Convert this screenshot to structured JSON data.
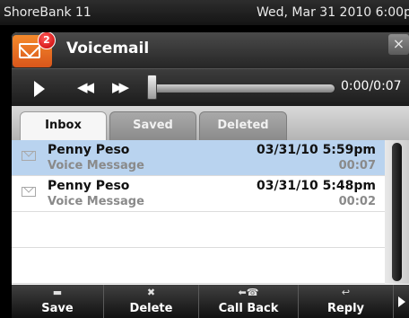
{
  "statusbar": {
    "carrier": "ShoreBank 11",
    "datetime": "Wed, Mar 31 2010 6:00pm"
  },
  "window": {
    "title": "Voicemail",
    "badge_count": "2",
    "close_glyph": "×",
    "app_icon": "envelope-icon"
  },
  "player": {
    "play_icon": "play-icon",
    "rewind_glyph": "◀◀",
    "ff_glyph": "▶▶",
    "position": 0,
    "time": "0:00/0:07"
  },
  "tabs": [
    {
      "label": "Inbox",
      "active": true
    },
    {
      "label": "Saved",
      "active": false
    },
    {
      "label": "Deleted",
      "active": false
    }
  ],
  "messages": [
    {
      "name": "Penny Peso",
      "type": "Voice Message",
      "date": "03/31/10 5:59pm",
      "duration": "00:07",
      "selected": true
    },
    {
      "name": "Penny Peso",
      "type": "Voice Message",
      "date": "03/31/10 5:48pm",
      "duration": "00:02",
      "selected": false
    }
  ],
  "toolbar": {
    "save": {
      "label": "Save",
      "icon": "folder-icon",
      "glyph": "▬"
    },
    "delete": {
      "label": "Delete",
      "icon": "x-icon",
      "glyph": "✖"
    },
    "callback": {
      "label": "Call Back",
      "icon": "phone-arrow-icon",
      "glyph": "⬅☎"
    },
    "reply": {
      "label": "Reply",
      "icon": "reply-arrow-icon",
      "glyph": "↩"
    }
  },
  "colors": {
    "accent_orange": "#e86a22",
    "selected_row": "#b9d3ef",
    "badge_red": "#d40000"
  }
}
